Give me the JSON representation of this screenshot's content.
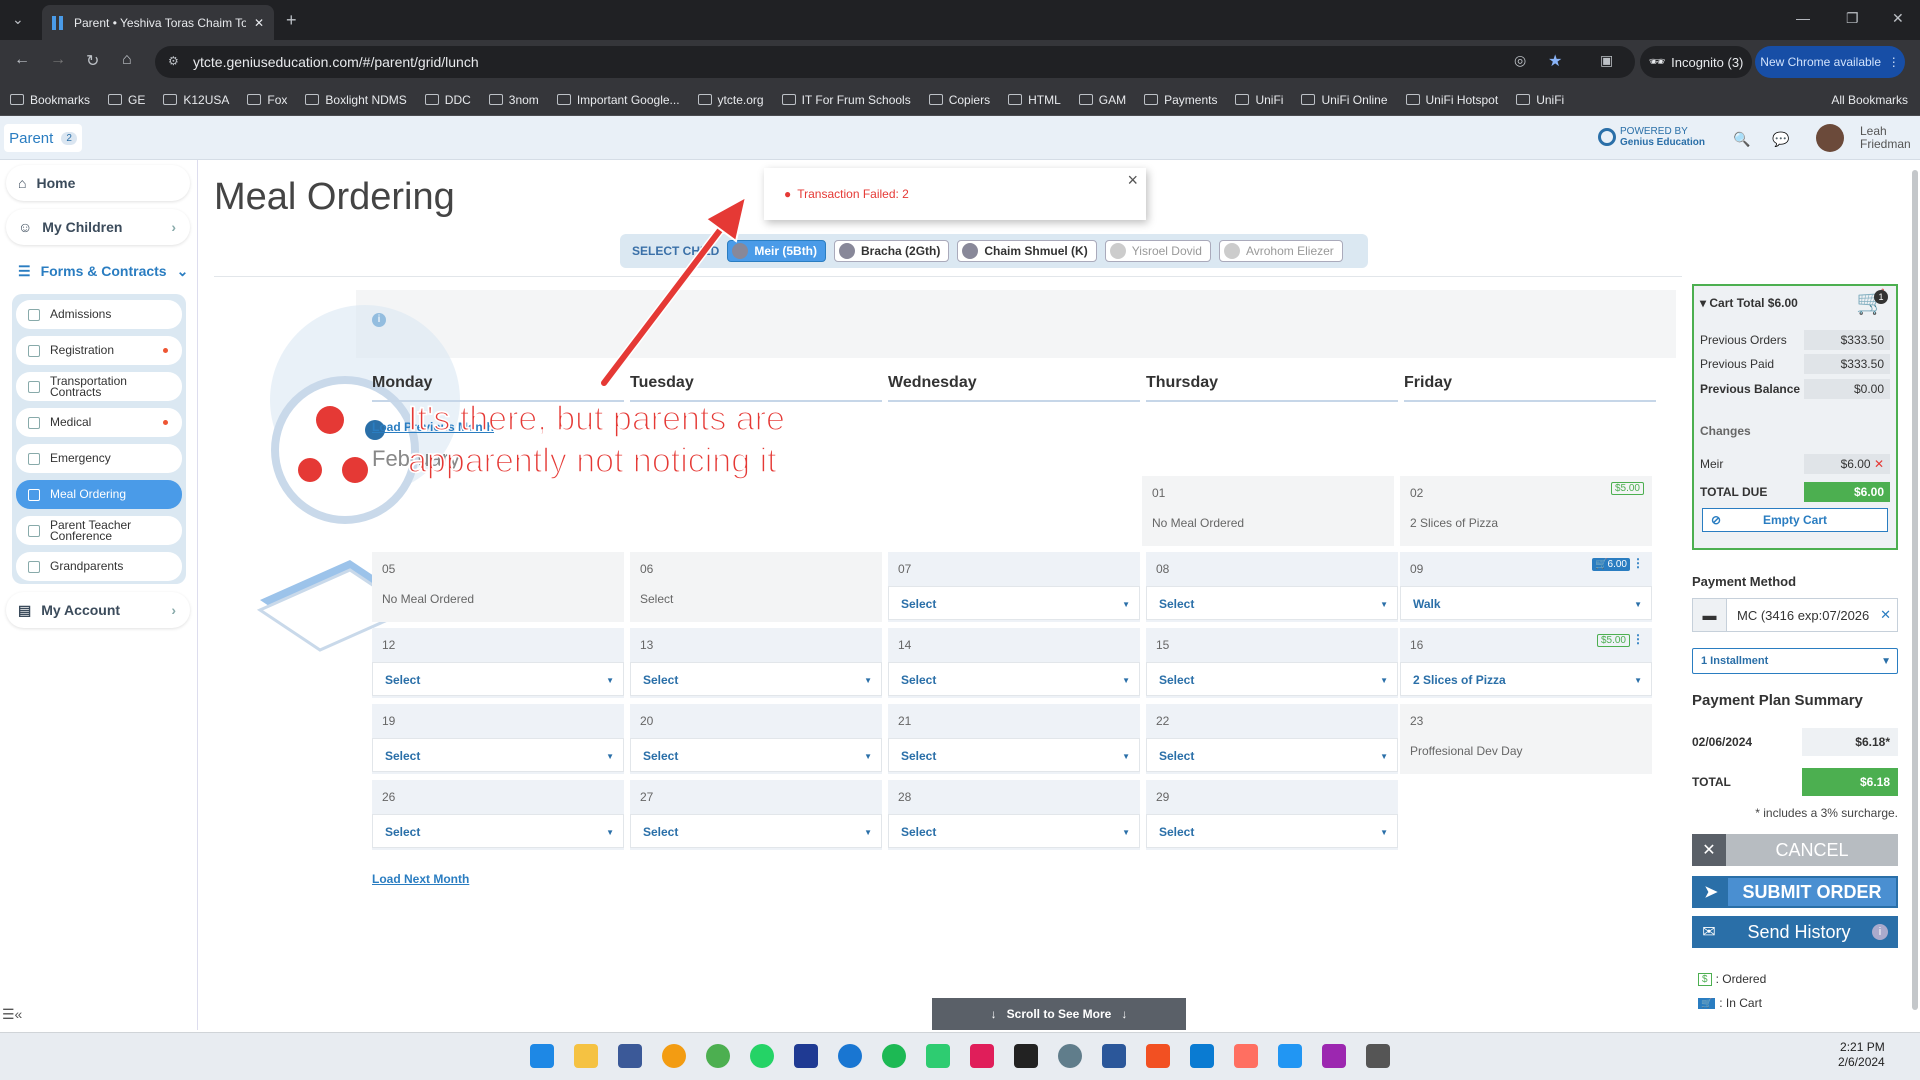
{
  "browser": {
    "tab_title": "Parent • Yeshiva Toras Chaim To",
    "url": "ytcte.geniuseducation.com/#/parent/grid/lunch",
    "incognito": "Incognito (3)",
    "new_chrome": "New Chrome available",
    "bookmarks": [
      "Bookmarks",
      "GE",
      "K12USA",
      "Fox",
      "Boxlight NDMS",
      "DDC",
      "3nom",
      "Important Google...",
      "ytcte.org",
      "IT For Frum Schools",
      "Copiers",
      "HTML",
      "GAM",
      "Payments",
      "UniFi",
      "UniFi Online",
      "UniFi Hotspot",
      "UniFi"
    ],
    "all_bookmarks": "All Bookmarks"
  },
  "header": {
    "parent_label": "Parent",
    "parent_count": "2",
    "powered_by": "POWERED BY",
    "brand": "Genius Education",
    "user_first": "Leah",
    "user_last": "Friedman"
  },
  "sidebar": {
    "home": "Home",
    "my_children": "My Children",
    "forms": "Forms & Contracts",
    "subitems": [
      "Admissions",
      "Registration",
      "Transportation Contracts",
      "Medical",
      "Emergency",
      "Meal Ordering",
      "Parent Teacher Conference",
      "Grandparents"
    ],
    "my_account": "My Account"
  },
  "page": {
    "title": "Meal Ordering",
    "toast": "Transaction Failed: 2"
  },
  "select_children": {
    "label": "SELECT CHILD",
    "kids": [
      "Meir (5Bth)",
      "Bracha (2Gth)",
      "Chaim Shmuel (K)",
      "Yisroel Dovid",
      "Avrohom Eliezer"
    ]
  },
  "calendar": {
    "days": [
      "Monday",
      "Tuesday",
      "Wednesday",
      "Thursday",
      "Friday"
    ],
    "load_prev": "Load Previous Month",
    "month": "February",
    "load_next": "Load Next Month",
    "cells": {
      "c01": {
        "num": "01",
        "val": "No Meal Ordered"
      },
      "c02": {
        "num": "02",
        "val": "2 Slices of Pizza",
        "badge": "5.00"
      },
      "c05": {
        "num": "05",
        "val": "No Meal Ordered"
      },
      "c06": {
        "num": "06",
        "val": "Select"
      },
      "c07": {
        "num": "07",
        "val": "Select"
      },
      "c08": {
        "num": "08",
        "val": "Select"
      },
      "c09": {
        "num": "09",
        "val": "Walk",
        "badge": "6.00"
      },
      "c12": {
        "num": "12",
        "val": "Select"
      },
      "c13": {
        "num": "13",
        "val": "Select"
      },
      "c14": {
        "num": "14",
        "val": "Select"
      },
      "c15": {
        "num": "15",
        "val": "Select"
      },
      "c16": {
        "num": "16",
        "val": "2 Slices of Pizza",
        "badge": "5.00"
      },
      "c19": {
        "num": "19",
        "val": "Select"
      },
      "c20": {
        "num": "20",
        "val": "Select"
      },
      "c21": {
        "num": "21",
        "val": "Select"
      },
      "c22": {
        "num": "22",
        "val": "Select"
      },
      "c23": {
        "num": "23",
        "val": "Proffesional Dev Day"
      },
      "c26": {
        "num": "26",
        "val": "Select"
      },
      "c27": {
        "num": "27",
        "val": "Select"
      },
      "c28": {
        "num": "28",
        "val": "Select"
      },
      "c29": {
        "num": "29",
        "val": "Select"
      }
    },
    "scroll_more": "Scroll to See More"
  },
  "annotation": {
    "line1": "It's there, but parents are",
    "line2": "apparently not noticing it"
  },
  "cart": {
    "title": "Cart Total $6.00",
    "count": "1",
    "prev_orders_label": "Previous Orders",
    "prev_orders": "$333.50",
    "prev_paid_label": "Previous Paid",
    "prev_paid": "$333.50",
    "prev_balance_label": "Previous Balance",
    "prev_balance": "$0.00",
    "changes_label": "Changes",
    "change_name": "Meir",
    "change_amount": "$6.00",
    "total_due_label": "TOTAL DUE",
    "total_due": "$6.00",
    "empty_cart": "Empty Cart"
  },
  "payment": {
    "method_label": "Payment Method",
    "method": "MC (3416 exp:07/2026",
    "installment": "1 Installment",
    "summary_label": "Payment Plan Summary",
    "date": "02/06/2024",
    "date_amount": "$6.18*",
    "total_label": "TOTAL",
    "total": "$6.18",
    "surcharge": "* includes a 3% surcharge.",
    "cancel": "CANCEL",
    "submit": "SUBMIT ORDER",
    "history": "Send History",
    "legend_ordered": ": Ordered",
    "legend_cart": ": In Cart"
  },
  "clock": {
    "time": "2:21 PM",
    "date": "2/6/2024"
  }
}
